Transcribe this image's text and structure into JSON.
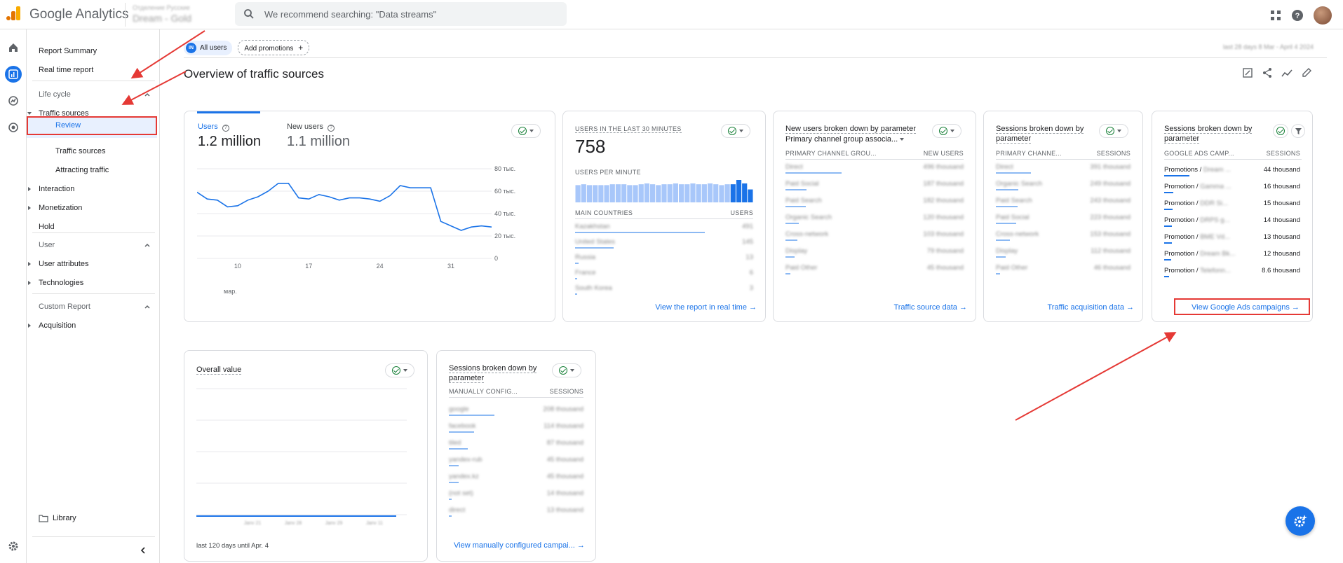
{
  "app": {
    "title": "Google Analytics",
    "account_line1": "Отделение Русские",
    "account_line2": "Dream - Gold"
  },
  "search": {
    "placeholder": "We recommend searching: \"Data streams\""
  },
  "sidebar": {
    "report_summary": "Report Summary",
    "real_time": "Real time report",
    "life_cycle": "Life cycle",
    "traffic_sources": "Traffic sources",
    "review": "Review",
    "traffic_sources_sub": "Traffic sources",
    "attracting_traffic": "Attracting traffic",
    "interaction": "Interaction",
    "monetization": "Monetization",
    "hold": "Hold",
    "user": "User",
    "user_attributes": "User attributes",
    "technologies": "Technologies",
    "custom_report": "Custom Report",
    "acquisition": "Acquisition",
    "library": "Library"
  },
  "filters": {
    "user_badge": "IN",
    "all_users": "All users",
    "add_promotions": "Add promotions"
  },
  "date_range": "last 28 days  8 Mar - April 4 2024",
  "page_title": "Overview of traffic sources",
  "card_users": {
    "metric1_label": "Users",
    "metric1_value": "1.2 million",
    "metric2_label": "New users",
    "metric2_value": "1.1 million",
    "y_ticks": [
      "80 тыс.",
      "60 тыс.",
      "40 тыс.",
      "20 тыс.",
      "0"
    ],
    "x_ticks": [
      "10",
      "17",
      "24",
      "31"
    ],
    "x_sub": "мар."
  },
  "card_realtime": {
    "label": "USERS IN THE LAST 30 MINUTES",
    "value": "758",
    "per_minute": "USERS PER MINUTE",
    "col1": "MAIN COUNTRIES",
    "col2": "USERS",
    "rows": [
      {
        "name": "Kazakhstan",
        "value": "491"
      },
      {
        "name": "United States",
        "value": "145"
      },
      {
        "name": "Russia",
        "value": "13"
      },
      {
        "name": "France",
        "value": "6"
      },
      {
        "name": "South Korea",
        "value": "3"
      }
    ],
    "link": "View the report in real time"
  },
  "card_new_users": {
    "title": "New users broken down by parameter",
    "subtitle": "Primary channel group associa...",
    "col1": "PRIMARY CHANNEL GROU...",
    "col2": "NEW USERS",
    "rows": [
      {
        "name": "Direct",
        "value": "496 thousand"
      },
      {
        "name": "Paid Social",
        "value": "187 thousand"
      },
      {
        "name": "Paid Search",
        "value": "182 thousand"
      },
      {
        "name": "Organic Search",
        "value": "120 thousand"
      },
      {
        "name": "Cross-network",
        "value": "103 thousand"
      },
      {
        "name": "Display",
        "value": "79 thousand"
      },
      {
        "name": "Paid Other",
        "value": "45 thousand"
      }
    ],
    "link": "Traffic source data"
  },
  "card_sessions": {
    "title": "Sessions broken down by parameter",
    "col1": "PRIMARY CHANNE...",
    "col2": "SESSIONS",
    "rows": [
      {
        "name": "Direct",
        "value": "391 thousand"
      },
      {
        "name": "Organic Search",
        "value": "249 thousand"
      },
      {
        "name": "Paid Search",
        "value": "243 thousand"
      },
      {
        "name": "Paid Social",
        "value": "223 thousand"
      },
      {
        "name": "Cross-network",
        "value": "153 thousand"
      },
      {
        "name": "Display",
        "value": "112 thousand"
      },
      {
        "name": "Paid Other",
        "value": "46 thousand"
      }
    ],
    "link": "Traffic acquisition data"
  },
  "card_ads": {
    "title": "Sessions broken down by parameter",
    "col1": "GOOGLE ADS CAMP...",
    "col2": "SESSIONS",
    "rows": [
      {
        "name": "Promotions /",
        "hidden": "Dream ...",
        "value": "44 thousand"
      },
      {
        "name": "Promotion /",
        "hidden": "Gamma ...",
        "value": "16 thousand"
      },
      {
        "name": "Promotion /",
        "hidden": "DDR Si...",
        "value": "15 thousand"
      },
      {
        "name": "Promotion /",
        "hidden": "DRPS g...",
        "value": "14 thousand"
      },
      {
        "name": "Promotion /",
        "hidden": "BME Vd...",
        "value": "13 thousand"
      },
      {
        "name": "Promotion /",
        "hidden": "Dream Bk...",
        "value": "12 thousand"
      },
      {
        "name": "Promotion /",
        "hidden": "Telefonn...",
        "value": "8.6 thousand"
      }
    ],
    "link": "View Google Ads campaigns"
  },
  "card_overall": {
    "title": "Overall value",
    "x_ticks": [
      "Janv 21",
      "Janv 28",
      "Janv 29",
      "Janv 11"
    ],
    "footer": "last 120 days until Apr. 4"
  },
  "card_manual": {
    "title": "Sessions broken down by parameter",
    "col1": "MANUALLY CONFIG...",
    "col2": "SESSIONS",
    "rows": [
      {
        "name": "google",
        "value": "208 thousand"
      },
      {
        "name": "facebook",
        "value": "114 thousand"
      },
      {
        "name": "tiled",
        "value": "87 thousand"
      },
      {
        "name": "yandex-rub",
        "value": "45 thousand"
      },
      {
        "name": "yandex.kz",
        "value": "45 thousand"
      },
      {
        "name": "(not set)",
        "value": "14 thousand"
      },
      {
        "name": "direct",
        "value": "13 thousand"
      }
    ],
    "link": "View manually configured campai..."
  },
  "chart_data": [
    {
      "type": "line",
      "x": [
        "Mar 6",
        "Mar 7",
        "Mar 8",
        "Mar 9",
        "Mar 10",
        "Mar 11",
        "Mar 12",
        "Mar 13",
        "Mar 14",
        "Mar 15",
        "Mar 16",
        "Mar 17",
        "Mar 18",
        "Mar 19",
        "Mar 20",
        "Mar 21",
        "Mar 22",
        "Mar 23",
        "Mar 24",
        "Mar 25",
        "Mar 26",
        "Mar 27",
        "Mar 28",
        "Mar 29",
        "Mar 30",
        "Mar 31",
        "Apr 1",
        "Apr 2",
        "Apr 3",
        "Apr 4"
      ],
      "series": [
        {
          "values": [
            59,
            53,
            52,
            46,
            47,
            52,
            55,
            60,
            67,
            67,
            54,
            53,
            57,
            55,
            52,
            54,
            54,
            53,
            51,
            56,
            65,
            63,
            63,
            63,
            33,
            29,
            25,
            28,
            29,
            28
          ]
        }
      ],
      "ylim": [
        0,
        80
      ],
      "y_tick_labels": [
        "0",
        "20 тыс.",
        "40 тыс.",
        "60 тыс.",
        "80 тыс."
      ],
      "x_tick_labels": [
        "10",
        "17",
        "24",
        "31"
      ]
    },
    {
      "type": "bar",
      "values": [
        20,
        21,
        20,
        20,
        20,
        20,
        21,
        21,
        21,
        20,
        20,
        21,
        22,
        21,
        20,
        21,
        21,
        22,
        21,
        21,
        22,
        21,
        21,
        22,
        21,
        20,
        21,
        21,
        26,
        22,
        15
      ]
    }
  ]
}
